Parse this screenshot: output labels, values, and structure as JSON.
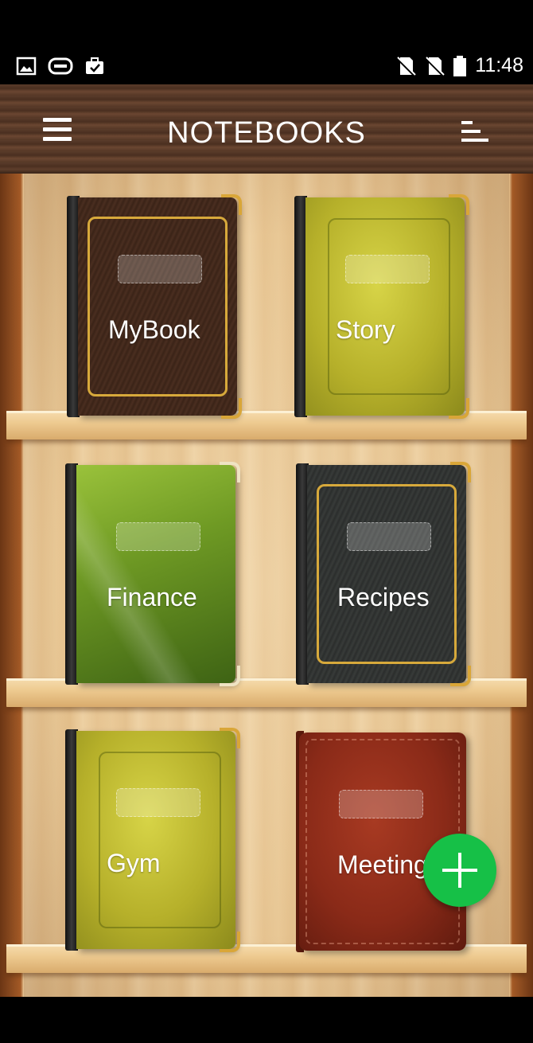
{
  "status_bar": {
    "left_icons": [
      "image-icon",
      "gamepad-icon",
      "briefcase-check-icon"
    ],
    "right_icons": [
      "no-sim-icon",
      "no-sim-icon",
      "battery-icon"
    ],
    "time": "11:48"
  },
  "app_bar": {
    "title": "NOTEBOOKS",
    "menu_icon": "hamburger-menu-icon",
    "sort_icon": "sort-icon"
  },
  "notebooks": [
    {
      "name": "MyBook",
      "style": "brown"
    },
    {
      "name": "Story",
      "style": "yellowgreen"
    },
    {
      "name": "Finance",
      "style": "green"
    },
    {
      "name": "Recipes",
      "style": "dark"
    },
    {
      "name": "Gym",
      "style": "yellowgreen"
    },
    {
      "name": "Meeting",
      "style": "red"
    }
  ],
  "fab": {
    "icon": "plus-icon",
    "color": "#16c047"
  },
  "colors": {
    "app_bar": "#5a3b2a",
    "shelf": "#e9c896",
    "gold_trim": "#d7a93b"
  }
}
